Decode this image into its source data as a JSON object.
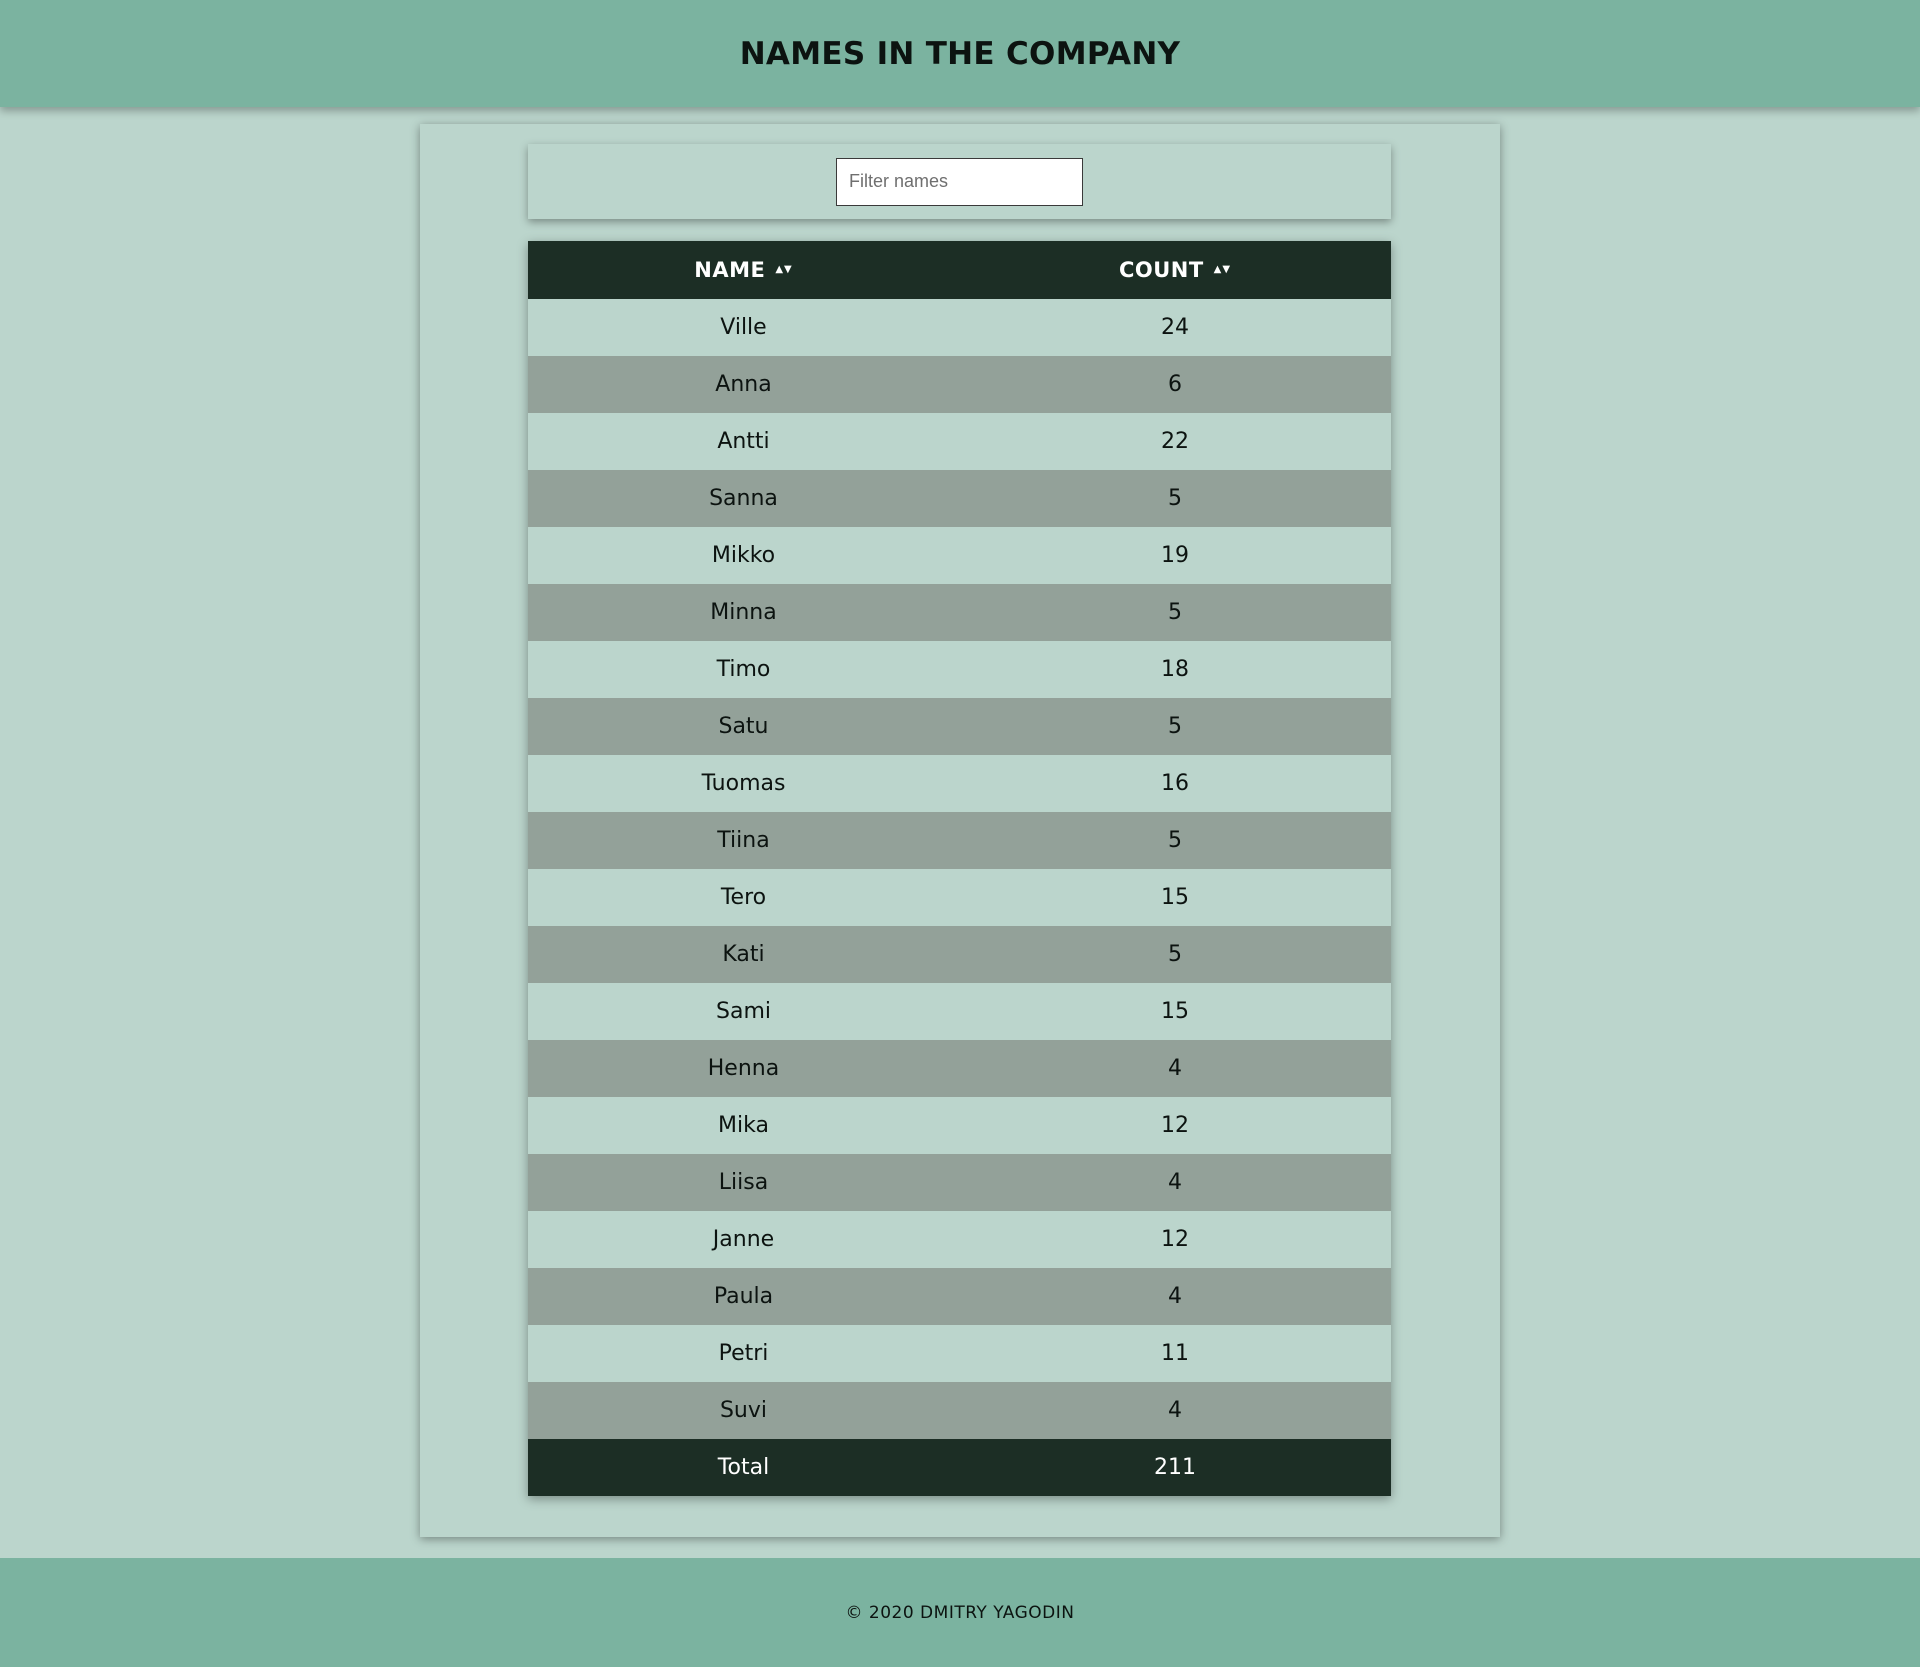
{
  "header": {
    "title": "NAMES IN THE COMPANY"
  },
  "filter": {
    "placeholder": "Filter names",
    "value": ""
  },
  "table": {
    "columns": [
      {
        "label": "NAME",
        "sort_icon": "sort-up-down-icon"
      },
      {
        "label": "COUNT",
        "sort_icon": "sort-up-down-icon"
      }
    ],
    "sort_glyph": "▲▼",
    "rows": [
      {
        "name": "Ville",
        "count": "24"
      },
      {
        "name": "Anna",
        "count": "6"
      },
      {
        "name": "Antti",
        "count": "22"
      },
      {
        "name": "Sanna",
        "count": "5"
      },
      {
        "name": "Mikko",
        "count": "19"
      },
      {
        "name": "Minna",
        "count": "5"
      },
      {
        "name": "Timo",
        "count": "18"
      },
      {
        "name": "Satu",
        "count": "5"
      },
      {
        "name": "Tuomas",
        "count": "16"
      },
      {
        "name": "Tiina",
        "count": "5"
      },
      {
        "name": "Tero",
        "count": "15"
      },
      {
        "name": "Kati",
        "count": "5"
      },
      {
        "name": "Sami",
        "count": "15"
      },
      {
        "name": "Henna",
        "count": "4"
      },
      {
        "name": "Mika",
        "count": "12"
      },
      {
        "name": "Liisa",
        "count": "4"
      },
      {
        "name": "Janne",
        "count": "12"
      },
      {
        "name": "Paula",
        "count": "4"
      },
      {
        "name": "Petri",
        "count": "11"
      },
      {
        "name": "Suvi",
        "count": "4"
      }
    ],
    "total": {
      "label": "Total",
      "value": "211"
    }
  },
  "footer": {
    "text": "© 2020 DMITRY YAGODIN"
  },
  "colors": {
    "header_bg": "#7bb3a0",
    "page_bg": "#bbd5cc",
    "table_head_bg": "#1c2e25",
    "row_alt_bg": "#93a199"
  }
}
